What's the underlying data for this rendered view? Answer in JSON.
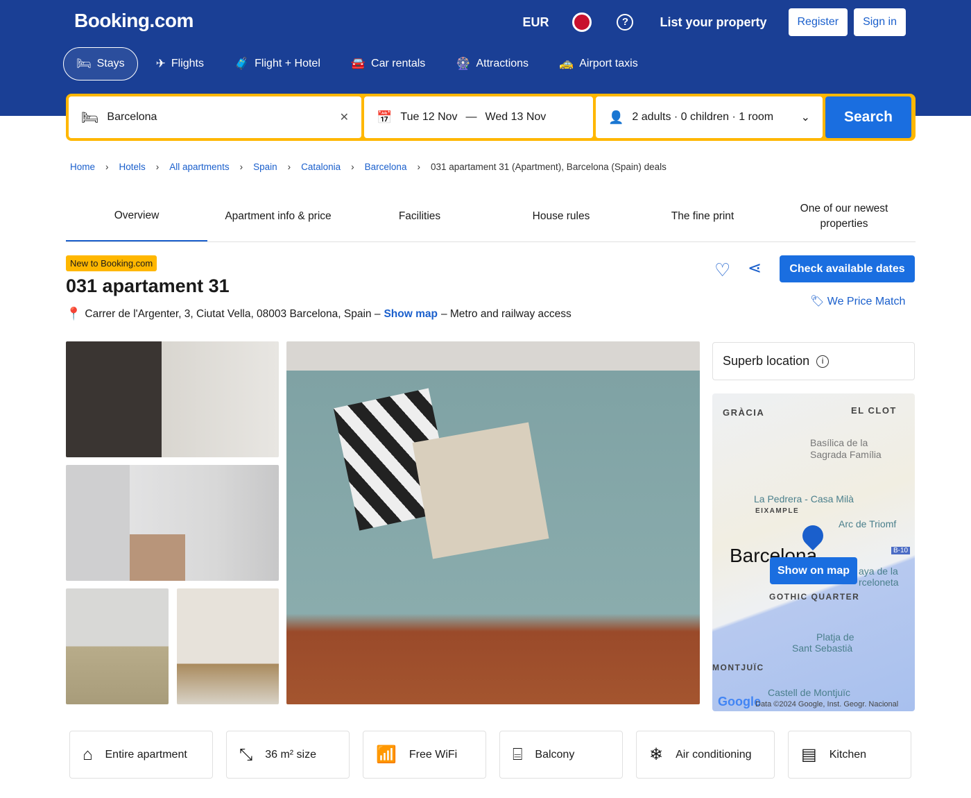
{
  "header": {
    "logo": "Booking.com",
    "currency": "EUR",
    "help": "?",
    "list_property": "List your property",
    "register": "Register",
    "sign_in": "Sign in"
  },
  "nav": [
    {
      "label": "Stays",
      "icon": "bed-icon",
      "glyph": "🛏"
    },
    {
      "label": "Flights",
      "icon": "plane-icon",
      "glyph": "✈"
    },
    {
      "label": "Flight + Hotel",
      "icon": "flight-hotel-icon",
      "glyph": "🧳"
    },
    {
      "label": "Car rentals",
      "icon": "car-icon",
      "glyph": "🚘"
    },
    {
      "label": "Attractions",
      "icon": "attractions-icon",
      "glyph": "🎡"
    },
    {
      "label": "Airport taxis",
      "icon": "taxi-icon",
      "glyph": "🚕"
    }
  ],
  "search": {
    "destination": "Barcelona",
    "dates_from": "Tue 12 Nov",
    "dash": "—",
    "dates_to": "Wed 13 Nov",
    "guests": "2 adults · 0 children · 1 room",
    "button": "Search",
    "clear": "✕",
    "chevron": "⌄"
  },
  "breadcrumb": [
    "Home",
    "Hotels",
    "All apartments",
    "Spain",
    "Catalonia",
    "Barcelona"
  ],
  "breadcrumb_current": "031 apartament 31 (Apartment), Barcelona (Spain) deals",
  "tabs": [
    "Overview",
    "Apartment info & price",
    "Facilities",
    "House rules",
    "The fine print",
    "One of our newest properties"
  ],
  "property": {
    "badge": "New to Booking.com",
    "title": "031 apartament 31",
    "address": "Carrer de l'Argenter, 3, Ciutat Vella, 08003 Barcelona, Spain –",
    "show_map": "Show map",
    "address_suffix": "– Metro and railway access",
    "check_dates": "Check available dates",
    "price_match": "We Price Match"
  },
  "location": {
    "label": "Superb location",
    "info": "i"
  },
  "map": {
    "labels": {
      "gracia": "GRÀCIA",
      "elclot": "EL CLOT",
      "sagrada1": "Basílica de la",
      "sagrada2": "Sagrada Família",
      "pedrera": "La Pedrera - Casa Milà",
      "eixample": "EIXAMPLE",
      "arc": "Arc de Triomf",
      "city": "Barcelona",
      "b10": "B-10",
      "barceloneta1": "aya de la",
      "barceloneta2": "rceloneta",
      "gothic": "GOTHIC QUARTER",
      "platja1": "Platja de",
      "platja2": "Sant Sebastià",
      "montjuic": "MONTJUÏC",
      "castell": "Castell de Montjuïc",
      "google": "Google",
      "credit": "Data ©2024 Google, Inst. Geogr. Nacional"
    },
    "button": "Show on map"
  },
  "features": [
    {
      "label": "Entire apartment",
      "icon": "house-icon",
      "glyph": "⌂"
    },
    {
      "label": "36 m² size",
      "icon": "size-icon",
      "glyph": "⤡"
    },
    {
      "label": "Free WiFi",
      "icon": "wifi-icon",
      "glyph": "📶"
    },
    {
      "label": "Balcony",
      "icon": "balcony-icon",
      "glyph": "⌸"
    },
    {
      "label": "Air conditioning",
      "icon": "snowflake-icon",
      "glyph": "❄"
    },
    {
      "label": "Kitchen",
      "icon": "kitchen-icon",
      "glyph": "▤"
    }
  ],
  "colors": {
    "brand": "#1a3f95",
    "accent": "#1a6ee0",
    "yellow": "#ffb700"
  }
}
